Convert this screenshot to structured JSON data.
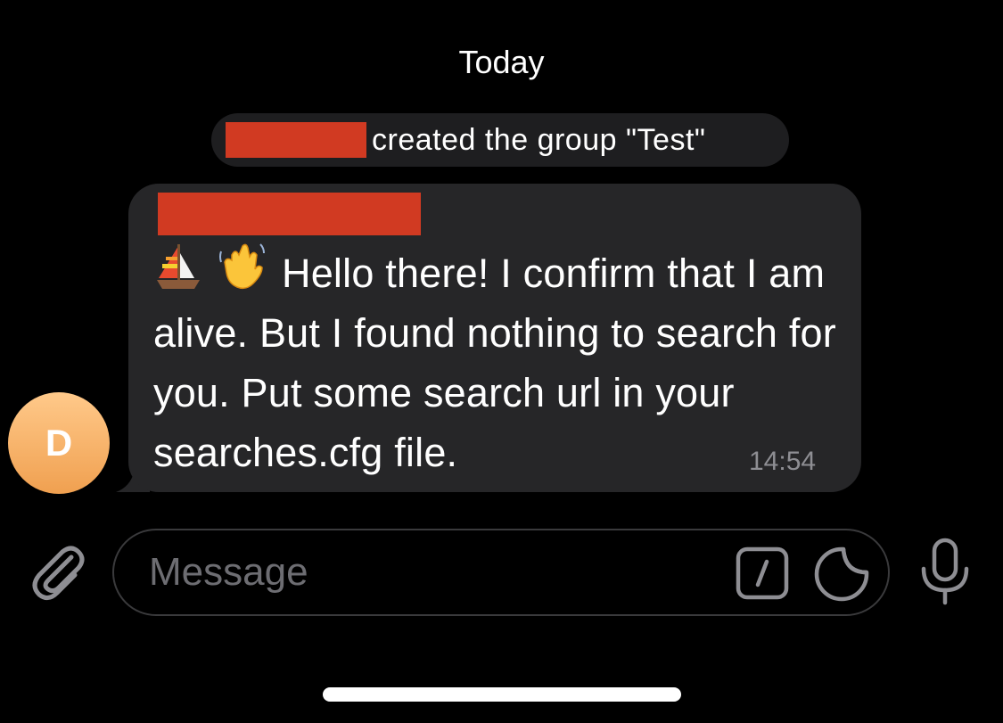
{
  "chat": {
    "date_header": "Today",
    "service_message": {
      "text": "created the group \"Test\"",
      "redacted": true
    },
    "message": {
      "sender_redacted": true,
      "emojis": [
        "sailboat-icon",
        "waving-hand-icon"
      ],
      "text": "Hello there! I confirm that I am alive. But I found nothing to search for you. Put some search url in your searches.cfg file.",
      "time": "14:54"
    },
    "avatar": {
      "initial": "D",
      "color_top": "#ffc98a",
      "color_bottom": "#f0a050"
    }
  },
  "composer": {
    "placeholder": "Message",
    "icons": [
      "paperclip-icon",
      "slash-command-icon",
      "sticker-icon",
      "microphone-icon"
    ]
  },
  "colors": {
    "background": "#000000",
    "bubble": "#262628",
    "redaction": "#d13a22",
    "timestamp": "#8e8e93",
    "placeholder": "#6d6d72"
  }
}
